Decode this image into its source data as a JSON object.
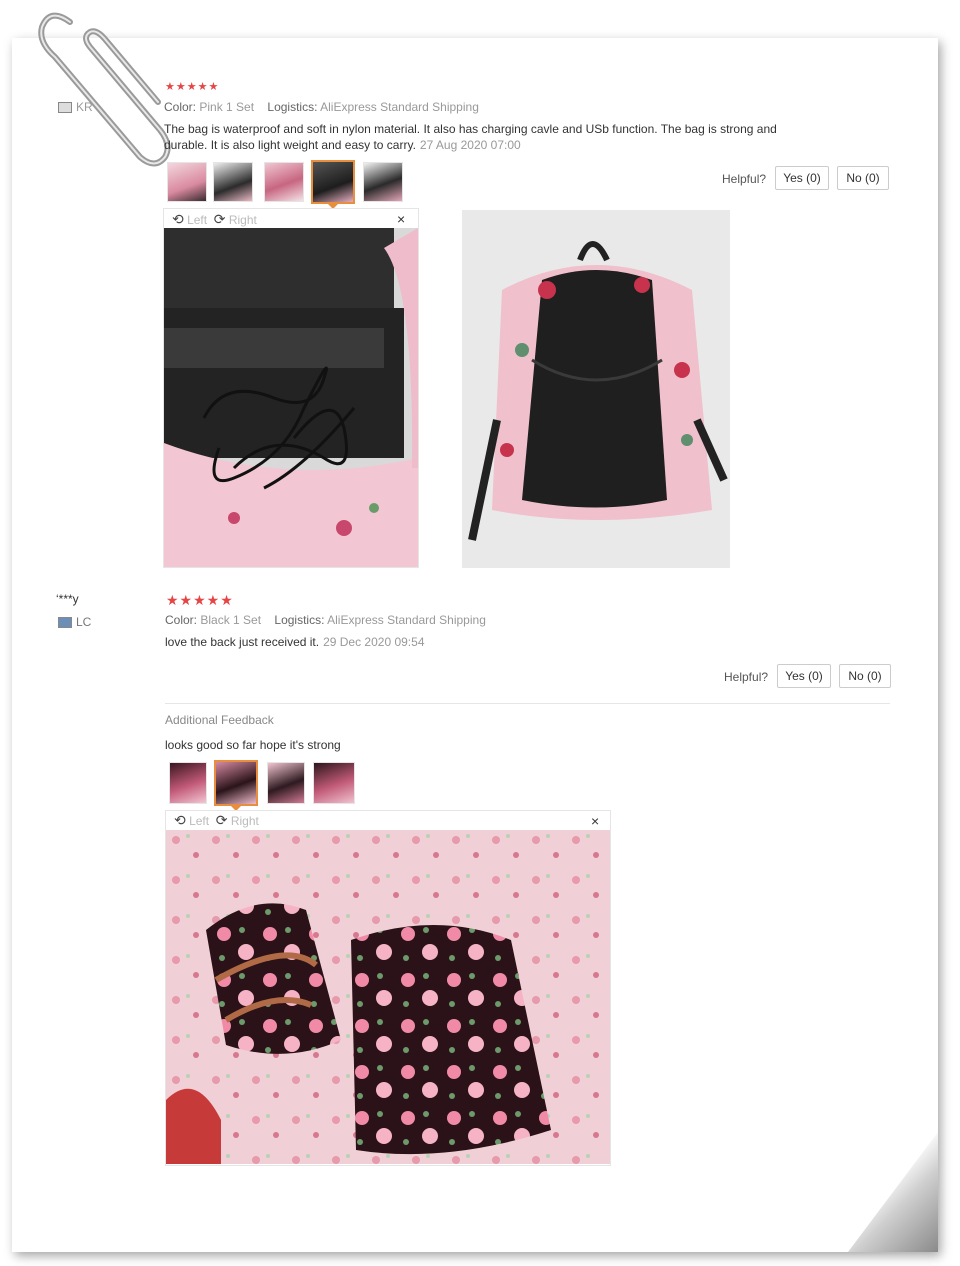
{
  "review1": {
    "country": "KR",
    "stars": "★★★★★",
    "color_label": "Color:",
    "color_value": "Pink 1 Set",
    "logistics_label": "Logistics:",
    "logistics_value": "AliExpress Standard Shipping",
    "text_line1": "The bag is waterproof and soft in nylon material. It also has charging cavle and USb function. The bag is strong and",
    "text_line2": "durable. It is also light weight and easy to carry.",
    "date": "27 Aug 2020 07:00",
    "helpful_label": "Helpful?",
    "yes_label": "Yes (0)",
    "no_label": "No (0)",
    "viewer_left": "Left",
    "viewer_right": "Right",
    "close_glyph": "×"
  },
  "review2": {
    "username": "‘***y",
    "country": "LC",
    "stars": "★★★★★",
    "color_label": "Color:",
    "color_value": "Black 1 Set",
    "logistics_label": "Logistics:",
    "logistics_value": "AliExpress Standard Shipping",
    "text": "love the back just received it.",
    "date": "29 Dec 2020 09:54",
    "helpful_label": "Helpful?",
    "yes_label": "Yes (0)",
    "no_label": "No (0)",
    "additional_title": "Additional Feedback",
    "additional_text": "looks good so far hope it's strong",
    "viewer_left": "Left",
    "viewer_right": "Right",
    "close_glyph": "×"
  },
  "icons": {
    "rotate_left": "⟲",
    "rotate_right": "⟳"
  },
  "colors": {
    "star": "#e64545",
    "selected_thumb": "#e78f3e"
  }
}
